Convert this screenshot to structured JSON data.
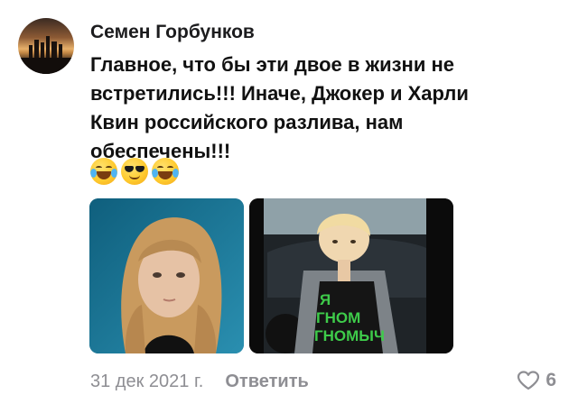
{
  "comment": {
    "author": "Семен Горбунков",
    "text": "Главное, что бы эти двое в жизни не\nвстретились!!! Иначе, Джокер и Харли\nКвин российского разлива, нам\nобеспечены!!!",
    "emojis": [
      "tears-of-joy-emoji",
      "sunglasses-emoji",
      "tears-of-joy-emoji"
    ],
    "photos": [
      {
        "name": "girl-photo"
      },
      {
        "name": "boy-photo",
        "shirt_text": [
          "Я",
          "ГНОМ",
          "ГНОМЫЧ"
        ]
      }
    ],
    "date": "31 дек 2021 г.",
    "reply_label": "Ответить",
    "likes": "6"
  },
  "colors": {
    "secondary_text": "#8e8e93",
    "shirt_text": "#3ecb4a"
  }
}
